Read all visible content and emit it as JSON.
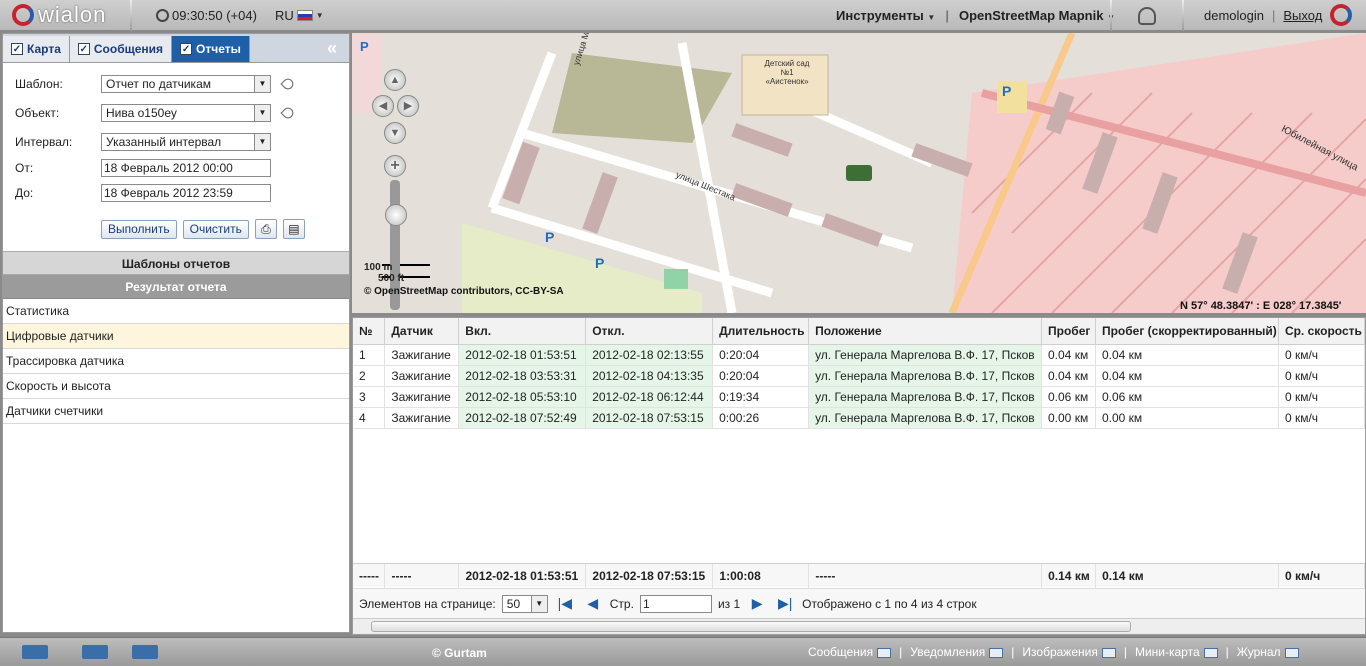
{
  "topbar": {
    "logo_text": "wialon",
    "clock": "09:30:50 (+04)",
    "language": "RU",
    "tools_label": "Инструменты",
    "map_source": "OpenStreetMap Mapnik",
    "username": "demologin",
    "logout": "Выход"
  },
  "tabs": [
    {
      "label": "Карта",
      "checked": true
    },
    {
      "label": "Сообщения",
      "checked": true
    },
    {
      "label": "Отчеты",
      "checked": true
    }
  ],
  "form": {
    "template_label": "Шаблон:",
    "template_value": "Отчет по датчикам",
    "object_label": "Объект:",
    "object_value": "Нива о150еу",
    "interval_label": "Интервал:",
    "interval_value": "Указанный интервал",
    "from_label": "От:",
    "from_value": "18 Февраль 2012 00:00",
    "to_label": "До:",
    "to_value": "18 Февраль 2012 23:59",
    "run_button": "Выполнить",
    "clear_button": "Очистить"
  },
  "sections": {
    "templates_header": "Шаблоны отчетов",
    "result_header": "Результат отчета"
  },
  "result_items": [
    {
      "label": "Статистика"
    },
    {
      "label": "Цифровые датчики"
    },
    {
      "label": "Трассировка датчика"
    },
    {
      "label": "Скорость и высота"
    },
    {
      "label": "Датчики счетчики"
    }
  ],
  "map": {
    "scale_metric": "100 m",
    "scale_imperial": "500 ft",
    "copyright": "© OpenStreetMap contributors, CC-BY-SA",
    "coords": "N 57° 48.3847' : E 028° 17.3845'",
    "street1": "улица Шестака",
    "street2": "Юбилейная улица",
    "street3": "улица Ма",
    "kindergarten": "Детский сад №1 «Аистенок»",
    "parking": "P"
  },
  "table": {
    "columns": [
      "№",
      "Датчик",
      "Вкл.",
      "Откл.",
      "Длительность",
      "Положение",
      "Пробег",
      "Пробег (скорректированный)",
      "Ср. скорость"
    ],
    "rows": [
      [
        "1",
        "Зажигание",
        "2012-02-18 01:53:51",
        "2012-02-18 02:13:55",
        "0:20:04",
        "ул. Генерала Маргелова В.Ф. 17, Псков",
        "0.04 км",
        "0.04 км",
        "0 км/ч"
      ],
      [
        "2",
        "Зажигание",
        "2012-02-18 03:53:31",
        "2012-02-18 04:13:35",
        "0:20:04",
        "ул. Генерала Маргелова В.Ф. 17, Псков",
        "0.04 км",
        "0.04 км",
        "0 км/ч"
      ],
      [
        "3",
        "Зажигание",
        "2012-02-18 05:53:10",
        "2012-02-18 06:12:44",
        "0:19:34",
        "ул. Генерала Маргелова В.Ф. 17, Псков",
        "0.06 км",
        "0.06 км",
        "0 км/ч"
      ],
      [
        "4",
        "Зажигание",
        "2012-02-18 07:52:49",
        "2012-02-18 07:53:15",
        "0:00:26",
        "ул. Генерала Маргелова В.Ф. 17, Псков",
        "0.00 км",
        "0.00 км",
        "0 км/ч"
      ]
    ],
    "totals": [
      "-----",
      "-----",
      "2012-02-18 01:53:51",
      "2012-02-18 07:53:15",
      "1:00:08",
      "-----",
      "0.14 км",
      "0.14 км",
      "0 км/ч"
    ]
  },
  "pager": {
    "per_page_label": "Элементов на странице:",
    "per_page_value": "50",
    "page_label": "Стр.",
    "page_value": "1",
    "of_label": "из 1",
    "shown": "Отображено с 1 по 4 из 4 строк"
  },
  "bottombar": {
    "brand": "© Gurtam",
    "messages": "Сообщения",
    "notifications": "Уведомления",
    "images": "Изображения",
    "minimap": "Мини-карта",
    "log": "Журнал"
  }
}
